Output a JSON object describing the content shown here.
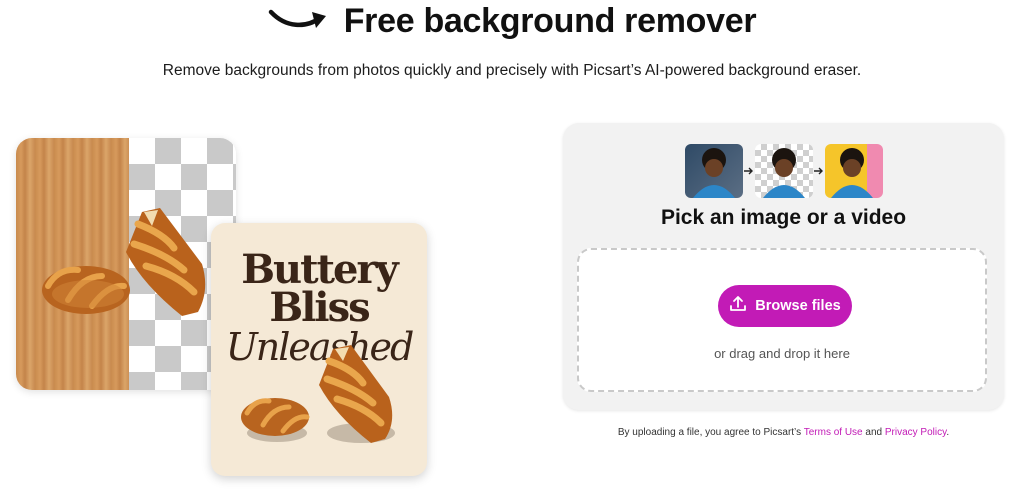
{
  "hero": {
    "title": "Free background remover",
    "subtitle": "Remove backgrounds from photos quickly and precisely with Picsart’s AI-powered background eraser."
  },
  "illustration": {
    "poster_line1": "Buttery",
    "poster_line2": "Bliss",
    "poster_line3": "Unleashed"
  },
  "upload": {
    "title": "Pick an image or a video",
    "browse_label": "Browse files",
    "drop_hint": "or drag and drop it here",
    "legal_prefix": "By uploading a file, you agree to Picsart’s",
    "terms_label": "Terms of Use",
    "and_text": "and",
    "privacy_label": "Privacy Policy",
    "legal_suffix": "."
  },
  "colors": {
    "accent": "#c21bb6",
    "panel_bg": "#f2f2f2"
  }
}
